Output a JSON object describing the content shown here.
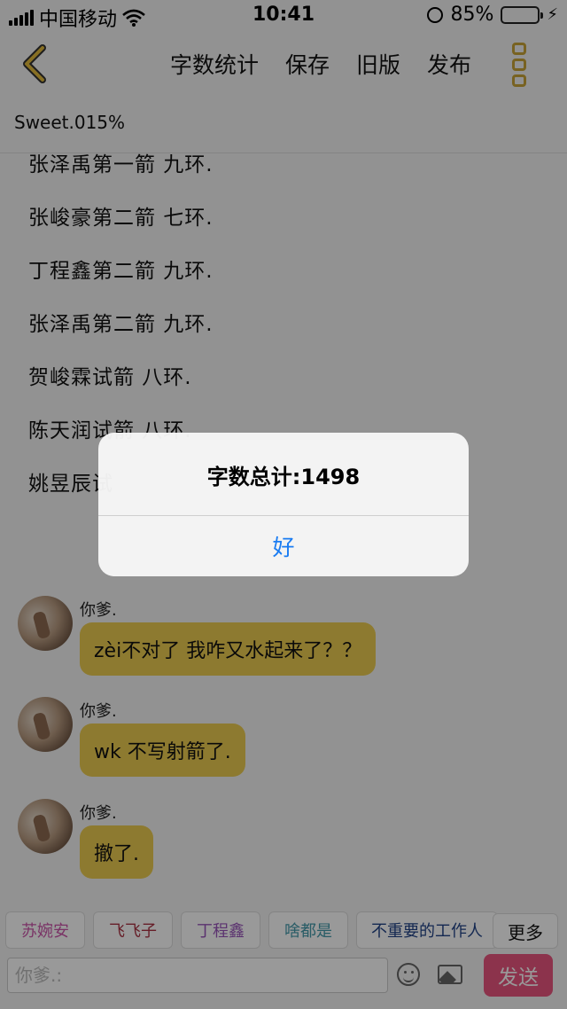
{
  "status_bar": {
    "carrier": "中国移动",
    "time": "10:41",
    "battery_percent": "85%",
    "battery_level": 0.85,
    "icons": [
      "signal-bars-icon",
      "wifi-icon",
      "rotation-lock-icon",
      "battery-icon",
      "charging-bolt-icon"
    ]
  },
  "nav": {
    "back_icon": "chevron-left-icon",
    "word_count": "字数统计",
    "save": "保存",
    "old_version": "旧版",
    "publish": "发布",
    "more_icon": "vertical-dots-icon",
    "accent": "#c8a437"
  },
  "document": {
    "title": "Sweet.015%",
    "lines": [
      "张泽禹第一箭 九环.",
      "张峻豪第二箭 七环.",
      "丁程鑫第二箭 九环.",
      "张泽禹第二箭 九环.",
      "贺峻霖试箭 八环.",
      "陈天润试箭 八环.",
      "姚昱辰试"
    ]
  },
  "chat": {
    "messages": [
      {
        "sender": "你爹.",
        "text": "zèi不对了 我咋又水起来了？？"
      },
      {
        "sender": "你爹.",
        "text": "wk 不写射箭了."
      },
      {
        "sender": "你爹.",
        "text": "撤了."
      }
    ],
    "bubble_color": "#eccb50"
  },
  "tags": {
    "items": [
      {
        "label": "苏婉安",
        "color": "#cc55aa"
      },
      {
        "label": "飞飞子",
        "color": "#aa3344"
      },
      {
        "label": "丁程鑫",
        "color": "#9955bb"
      },
      {
        "label": "啥都是",
        "color": "#4499aa"
      },
      {
        "label": "不重要的工作人",
        "color": "#224488"
      }
    ],
    "more": "更多"
  },
  "input": {
    "placeholder": "你爹.:",
    "emoji_icon": "emoji-icon",
    "image_icon": "image-icon",
    "send": "发送",
    "send_color": "#e9557f"
  },
  "alert": {
    "title": "字数总计:1498",
    "ok": "好"
  }
}
